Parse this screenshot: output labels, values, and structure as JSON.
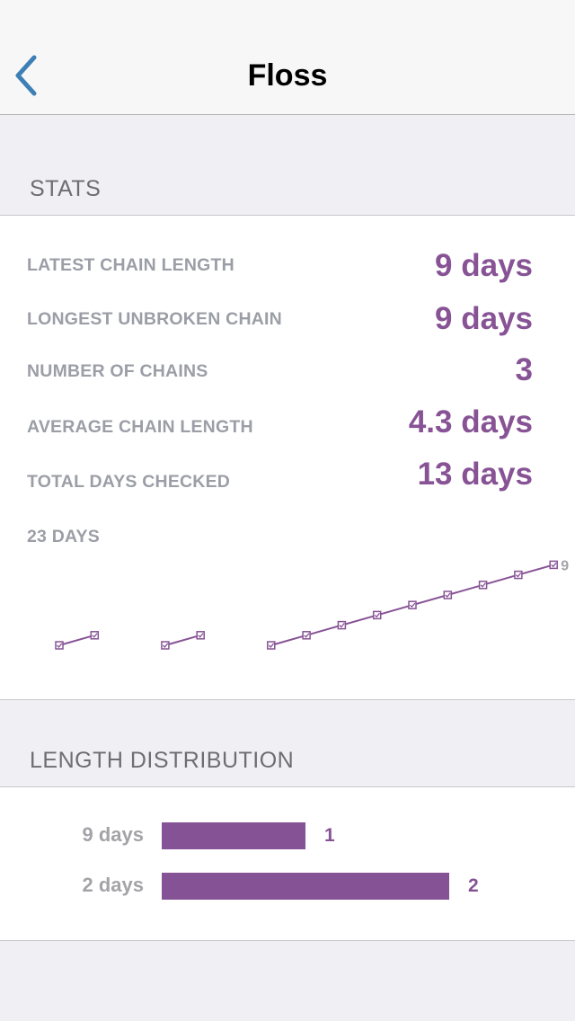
{
  "nav": {
    "title": "Floss",
    "back_icon": "chevron-left-icon",
    "accent": "#3e7fb5"
  },
  "stats": {
    "header": "STATS",
    "rows": [
      {
        "label": "LATEST CHAIN LENGTH",
        "value": "9 days"
      },
      {
        "label": "LONGEST UNBROKEN CHAIN",
        "value": "9 days"
      },
      {
        "label": "NUMBER OF CHAINS",
        "value": "3"
      },
      {
        "label": "AVERAGE CHAIN LENGTH",
        "value": "4.3 days"
      },
      {
        "label": "TOTAL DAYS CHECKED",
        "value": "13 days"
      }
    ],
    "history_label": "23 DAYS",
    "chart_data": {
      "type": "line",
      "x": [
        1,
        2,
        3,
        4,
        5,
        6,
        7,
        8,
        9,
        10,
        11,
        12,
        13,
        14,
        15,
        16,
        17,
        18,
        19,
        20,
        21,
        22,
        23
      ],
      "series": [
        {
          "values": [
            1,
            2,
            null,
            1,
            2,
            null,
            1,
            2,
            3,
            4,
            5,
            6,
            7,
            8,
            9
          ]
        }
      ],
      "end_label": "9",
      "color": "#875395"
    }
  },
  "distribution": {
    "header": "LENGTH DISTRIBUTION",
    "chart_data": {
      "type": "bar",
      "categories": [
        "9 days",
        "2 days"
      ],
      "values": [
        1,
        2
      ],
      "color": "#865296"
    }
  }
}
